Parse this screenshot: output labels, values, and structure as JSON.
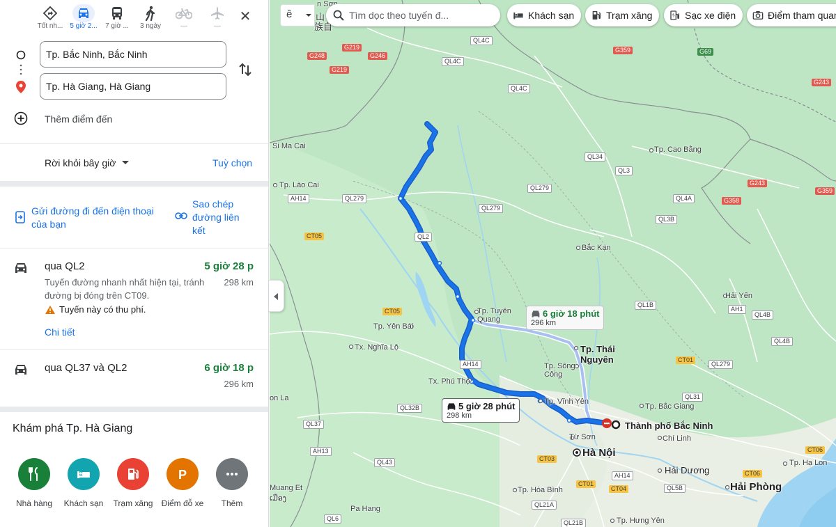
{
  "modes": [
    {
      "name": "mode-best",
      "icon": "diamond-direction-icon",
      "label": "Tốt nh..."
    },
    {
      "name": "mode-driving",
      "icon": "car-icon",
      "label": "5 giờ 2..."
    },
    {
      "name": "mode-transit",
      "icon": "bus-icon",
      "label": "7 giờ ..."
    },
    {
      "name": "mode-walking",
      "icon": "walk-icon",
      "label": "3 ngày"
    },
    {
      "name": "mode-cycling",
      "icon": "bicycle-icon",
      "label": "—"
    },
    {
      "name": "mode-flight",
      "icon": "plane-icon",
      "label": "—"
    }
  ],
  "directions": {
    "origin": "Tp. Bắc Ninh, Bắc Ninh",
    "destination": "Tp. Hà Giang, Hà Giang",
    "add_destination": "Thêm điểm đến",
    "depart": "Rời khỏi bây giờ",
    "options": "Tuỳ chọn",
    "send_to_phone": "Gửi đường đi đến điện thoại của bạn",
    "copy_link": "Sao chép đường liên kết"
  },
  "routes": [
    {
      "via": "qua QL2",
      "time": "5 giờ 28 p",
      "distance": "298 km",
      "description": "Tuyến đường nhanh nhất hiện tại, tránh đường bị đóng trên CT09.",
      "warning": "Tuyến này có thu phí.",
      "details": "Chi tiết"
    },
    {
      "via": "qua QL37 và QL2",
      "time": "6 giờ 18 p",
      "distance": "296 km"
    }
  ],
  "explore": {
    "title": "Khám phá Tp. Hà Giang",
    "categories": [
      {
        "label": "Nhà hàng",
        "icon": "restaurant-icon",
        "color": "#188038"
      },
      {
        "label": "Khách sạn",
        "icon": "hotel-icon",
        "color": "#12a4af"
      },
      {
        "label": "Trạm xăng",
        "icon": "gas-station-icon",
        "color": "#e94235"
      },
      {
        "label": "Điểm đỗ xe",
        "icon": "parking-icon",
        "color": "#e37400"
      },
      {
        "label": "Thêm",
        "icon": "more-icon",
        "color": "#70757a"
      }
    ]
  },
  "map": {
    "input_tool_glyph": "ê",
    "search_placeholder": "Tìm dọc theo tuyến đ...",
    "chips": [
      "Khách sạn",
      "Trạm xăng",
      "Sạc xe điện",
      "Điểm tham quan"
    ],
    "primary_callout": {
      "time": "5 giờ 28 phút",
      "distance": "298 km"
    },
    "alt_callout": {
      "time": "6 giờ 18 phút",
      "distance": "296 km"
    },
    "route_color": "#1a73e8",
    "alt_route_color": "#a8c0f0",
    "cities": {
      "ha_noi": "Hà Nội",
      "hai_phong": "Hải Phòng",
      "bac_ninh": "Thành phố Bắc Ninh",
      "thai_nguyen": "Tp. Thái Nguyên",
      "tuyen_quang": "Tp. Tuyên Quang",
      "hai_duong": "Hải Dương",
      "vinh_yen": "Tp. Vĩnh Yên",
      "phu_tho": "Tx. Phú Thọ",
      "bac_giang": "Tp. Bắc Giang",
      "cao_bang": "Tp. Cao Bằng",
      "bac_kan": "Bắc Kạn",
      "yen_bai": "Tp. Yên Bái",
      "nghia_lo": "Tx. Nghĩa Lộ",
      "lao_cai": "Tp. Lào Cai",
      "hoa_binh": "Tp. Hòa Bình",
      "hung_yen": "Tp. Hưng Yên",
      "song_cong": "Tp. Sông Công",
      "tu_son": "Từ Sơn",
      "chi_linh": "Chí Linh",
      "ha_long": "Tp. Hạ Lon",
      "hai_yen": "Hải Yến",
      "si_ma_cai": "Si Ma Cai",
      "on_la": "on La",
      "muang_et": "Muang Et",
      "pa_hang": "Pa Hang",
      "lao_script": "ເມືອງ",
      "van_son": "n Sơn",
      "tq_top": "山",
      "tq_left": "族自"
    },
    "shields": {
      "ql4c_a": "QL4C",
      "ql4c_b": "QL4C",
      "ql4c_c": "QL4C",
      "g219_a": "G219",
      "g219_b": "G219",
      "g248": "G248",
      "g246": "G246",
      "g359_a": "G359",
      "g359_b": "G359",
      "g69": "G69",
      "g243_a": "G243",
      "g243_b": "G243",
      "g358": "G358",
      "ql34": "QL34",
      "ql3": "QL3",
      "ql279_a": "QL279",
      "ql279_b": "QL279",
      "ql279_c": "QL279",
      "ql279_d": "QL279",
      "ql4a": "QL4A",
      "ql3b": "QL3B",
      "ql2": "QL2",
      "ql1b": "QL1B",
      "ql4b_a": "QL4B",
      "ql4b_b": "QL4B",
      "ah14_a": "AH14",
      "ah14_b": "AH14",
      "ah14_c": "AH14",
      "ah13": "AH13",
      "ah1": "AH1",
      "ct05_a": "CT05",
      "ct05_b": "CT05",
      "ct01_a": "CT01",
      "ct01_b": "CT01",
      "ct03": "CT03",
      "ct04": "CT04",
      "ct06_a": "CT06",
      "ct06_b": "CT06",
      "ql31": "QL31",
      "ql32b": "QL32B",
      "ql37": "QL37",
      "ql43": "QL43",
      "ql6": "QL6",
      "ql5b": "QL5B",
      "ql21a": "QL21A",
      "ql21b": "QL21B"
    }
  }
}
